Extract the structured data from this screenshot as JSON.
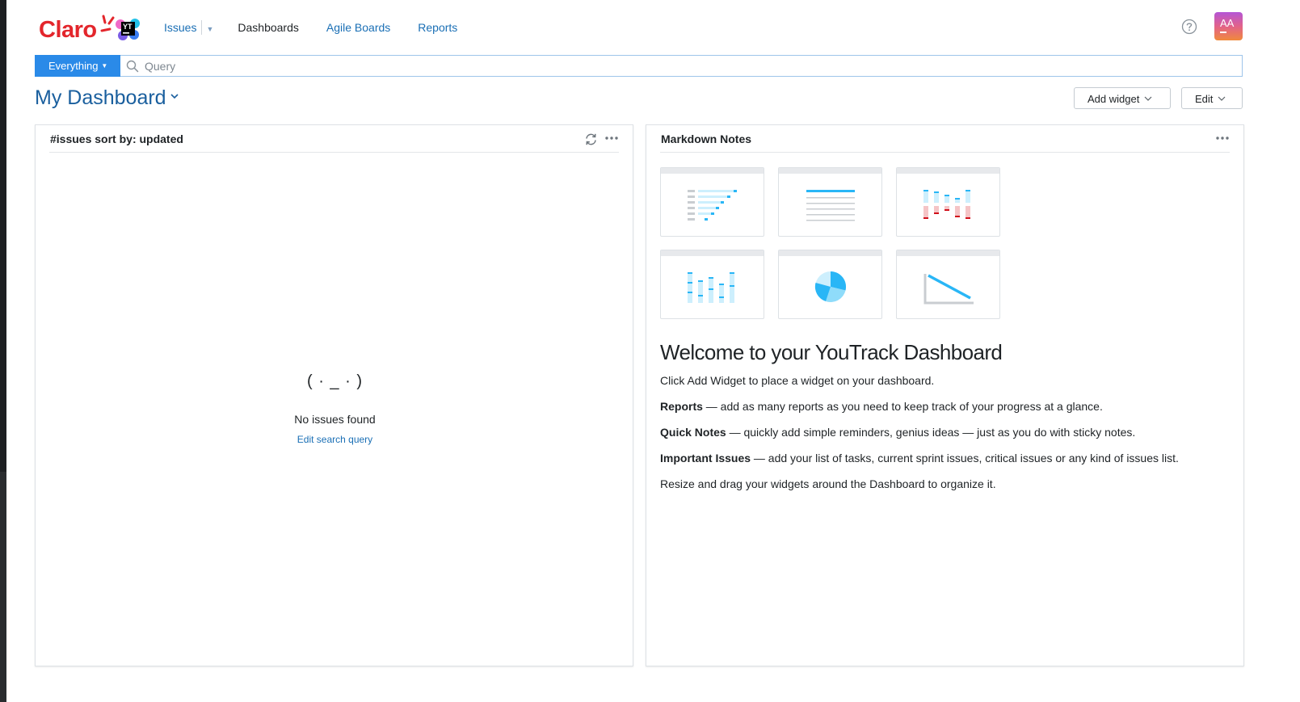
{
  "header": {
    "logo_text": "Claro",
    "logo_badge": "YT",
    "nav": [
      {
        "label": "Issues"
      },
      {
        "label": "Dashboards"
      },
      {
        "label": "Agile Boards"
      },
      {
        "label": "Reports"
      }
    ],
    "avatar_initials": "AA"
  },
  "search": {
    "context_label": "Everything",
    "placeholder": "Query"
  },
  "dashboard": {
    "title": "My Dashboard",
    "add_widget_label": "Add widget",
    "edit_label": "Edit"
  },
  "widget_issues": {
    "title": "#issues sort by: updated",
    "empty_face": "( · _ · )",
    "empty_text": "No issues found",
    "edit_link": "Edit search query"
  },
  "widget_notes": {
    "title": "Markdown Notes",
    "welcome_title": "Welcome to your YouTrack Dashboard",
    "intro": "Click Add Widget to place a widget on your dashboard.",
    "items": [
      {
        "bold": "Reports",
        "text": " — add as many reports as you need to keep track of your progress at a glance."
      },
      {
        "bold": "Quick Notes",
        "text": " — quickly add simple reminders, genius ideas — just as you do with sticky notes."
      },
      {
        "bold": "Important Issues",
        "text": " — add your list of tasks, current sprint issues, critical issues or any kind of issues list."
      }
    ],
    "outro": "Resize and drag your widgets around the Dashboard to organize it."
  },
  "colors": {
    "accent": "#2a8ae8",
    "link": "#1a6fb5",
    "brand_red": "#e3262c",
    "thumb_blue": "#29b6f6",
    "thumb_red": "#d0101b"
  }
}
